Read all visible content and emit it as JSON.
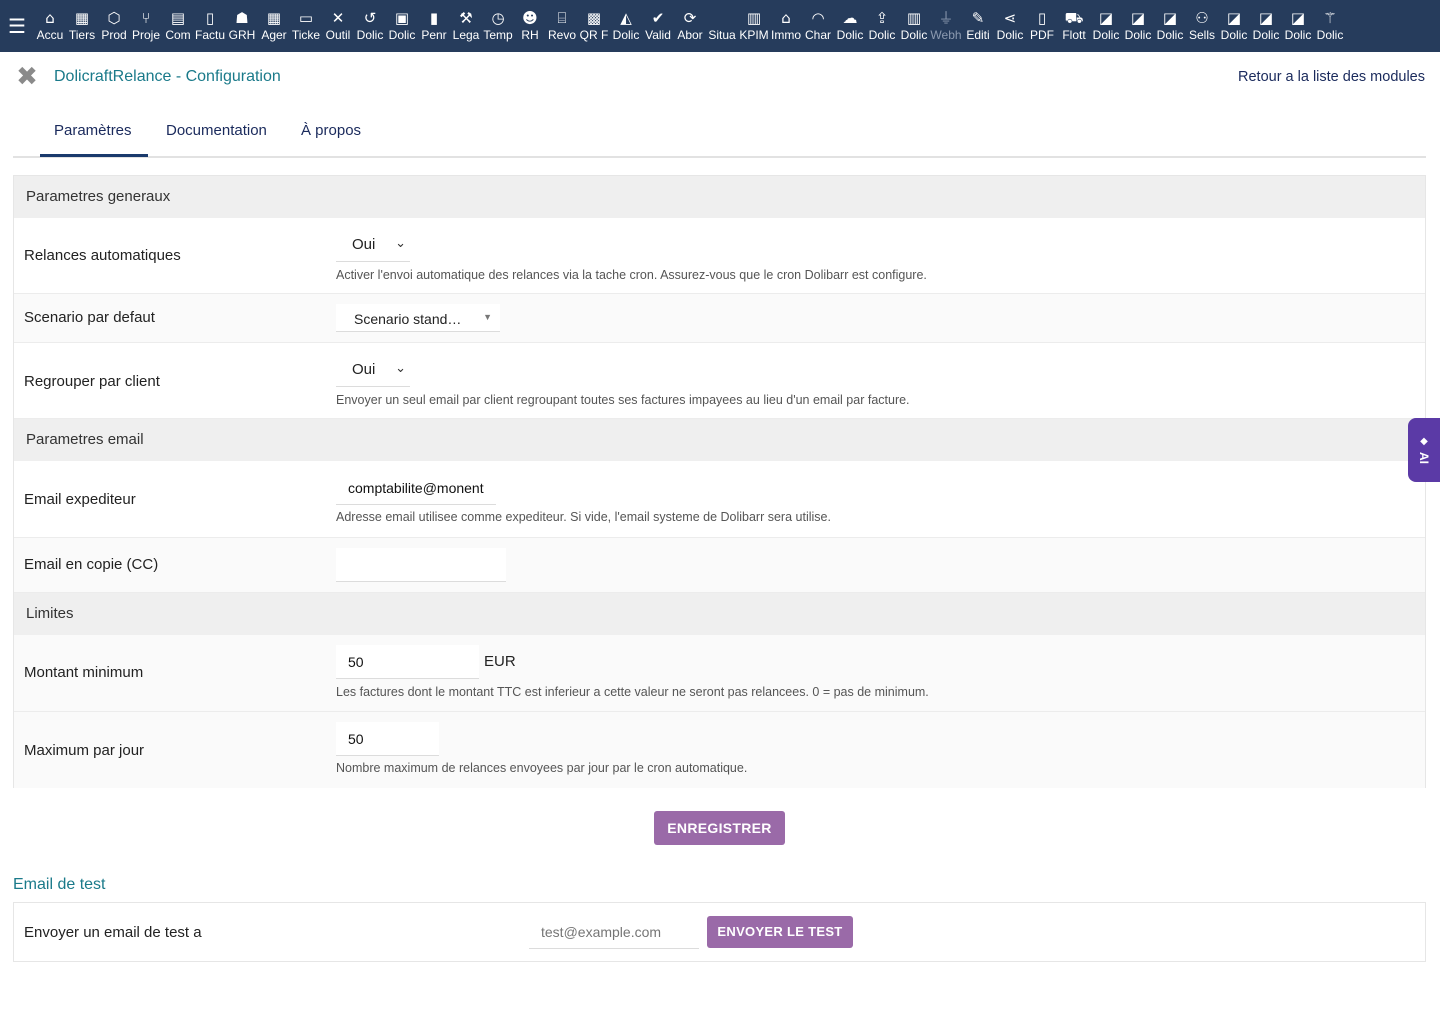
{
  "topbar": {
    "items": [
      {
        "icon": "home-icon",
        "glyph": "⌂",
        "label": "Accu"
      },
      {
        "icon": "building-icon",
        "glyph": "▦",
        "label": "Tiers"
      },
      {
        "icon": "cube-icon",
        "glyph": "⬡",
        "label": "Prod"
      },
      {
        "icon": "project-icon",
        "glyph": "⑂",
        "label": "Proje"
      },
      {
        "icon": "briefcase-icon",
        "glyph": "▤",
        "label": "Com"
      },
      {
        "icon": "invoice-icon",
        "glyph": "▯",
        "label": "Factu"
      },
      {
        "icon": "users-icon",
        "glyph": "☗",
        "label": "GRH"
      },
      {
        "icon": "calendar-icon",
        "glyph": "▦",
        "label": "Ager"
      },
      {
        "icon": "ticket-icon",
        "glyph": "▭",
        "label": "Ticke"
      },
      {
        "icon": "tools-icon",
        "glyph": "✕",
        "label": "Outil"
      },
      {
        "icon": "undo-icon",
        "glyph": "↺",
        "label": "Dolic"
      },
      {
        "icon": "toolbox-icon",
        "glyph": "▣",
        "label": "Dolic"
      },
      {
        "icon": "page-icon",
        "glyph": "▮",
        "label": "Penr"
      },
      {
        "icon": "gavel-icon",
        "glyph": "⚒",
        "label": "Lega"
      },
      {
        "icon": "clock-icon",
        "glyph": "◷",
        "label": "Temp"
      },
      {
        "icon": "team-icon",
        "glyph": "☻",
        "label": "RH"
      },
      {
        "icon": "bank-icon",
        "glyph": "⌸",
        "label": "Revo"
      },
      {
        "icon": "qrcode-icon",
        "glyph": "▩",
        "label": "QR F"
      },
      {
        "icon": "bell-icon",
        "glyph": "◭",
        "label": "Dolic"
      },
      {
        "icon": "check-double-icon",
        "glyph": "✔",
        "label": "Valid"
      },
      {
        "icon": "refresh-icon",
        "glyph": "⟳",
        "label": "Abor"
      },
      {
        "icon": "situation-icon",
        "glyph": " ",
        "label": "Situa"
      },
      {
        "icon": "chart-icon",
        "glyph": "▥",
        "label": "KPIM"
      },
      {
        "icon": "house-icon",
        "glyph": "⌂",
        "label": "Immo"
      },
      {
        "icon": "hard-hat-icon",
        "glyph": "◠",
        "label": "Char"
      },
      {
        "icon": "cloud-icon",
        "glyph": "☁",
        "label": "Dolic"
      },
      {
        "icon": "upload-icon",
        "glyph": "⇪",
        "label": "Dolic"
      },
      {
        "icon": "building2-icon",
        "glyph": "▥",
        "label": "Dolic"
      },
      {
        "icon": "plug-icon",
        "glyph": "⏚",
        "label": "Webh"
      },
      {
        "icon": "edit-icon",
        "glyph": "✎",
        "label": "Editi"
      },
      {
        "icon": "share-icon",
        "glyph": "⋖",
        "label": "Dolic"
      },
      {
        "icon": "pdf-icon",
        "glyph": "▯",
        "label": "PDF"
      },
      {
        "icon": "car-icon",
        "glyph": "⛟",
        "label": "Flott"
      },
      {
        "icon": "note-icon",
        "glyph": "◪",
        "label": "Dolic"
      },
      {
        "icon": "note-icon",
        "glyph": "◪",
        "label": "Dolic"
      },
      {
        "icon": "note-icon",
        "glyph": "◪",
        "label": "Dolic"
      },
      {
        "icon": "handshake-icon",
        "glyph": "⚇",
        "label": "Sells"
      },
      {
        "icon": "note-icon",
        "glyph": "◪",
        "label": "Dolic"
      },
      {
        "icon": "note-icon",
        "glyph": "◪",
        "label": "Dolic"
      },
      {
        "icon": "note-icon",
        "glyph": "◪",
        "label": "Dolic"
      },
      {
        "icon": "magic-wand-icon",
        "glyph": "⚚",
        "label": "Dolic"
      }
    ]
  },
  "header": {
    "title": "DolicraftRelance - Configuration",
    "back_link": "Retour a la liste des modules"
  },
  "tabs": [
    {
      "label": "Paramètres",
      "active": true
    },
    {
      "label": "Documentation",
      "active": false
    },
    {
      "label": "À propos",
      "active": false
    }
  ],
  "sections": {
    "general": {
      "title": "Parametres generaux",
      "relances_auto": {
        "label": "Relances automatiques",
        "value": "Oui",
        "help": "Activer l'envoi automatique des relances via la tache cron. Assurez-vous que le cron Dolibarr est configure."
      },
      "scenario": {
        "label": "Scenario par defaut",
        "value": "Scenario stand…"
      },
      "regrouper": {
        "label": "Regrouper par client",
        "value": "Oui",
        "help": "Envoyer un seul email par client regroupant toutes ses factures impayees au lieu d'un email par facture."
      }
    },
    "email": {
      "title": "Parametres email",
      "sender": {
        "label": "Email expediteur",
        "value": "comptabilite@monentre",
        "help": "Adresse email utilisee comme expediteur. Si vide, l'email systeme de Dolibarr sera utilise."
      },
      "cc": {
        "label": "Email en copie (CC)",
        "value": ""
      }
    },
    "limits": {
      "title": "Limites",
      "min_amount": {
        "label": "Montant minimum",
        "value": "50",
        "unit": "EUR",
        "help": "Les factures dont le montant TTC est inferieur a cette valeur ne seront pas relancees. 0 = pas de minimum."
      },
      "max_per_day": {
        "label": "Maximum par jour",
        "value": "50",
        "help": "Nombre maximum de relances envoyees par jour par le cron automatique."
      }
    }
  },
  "save_button": "ENREGISTRER",
  "test": {
    "title": "Email de test",
    "label": "Envoyer un email de test a",
    "placeholder": "test@example.com",
    "button": "ENVOYER LE TEST"
  },
  "ai_tab": {
    "label": "AI"
  },
  "colors": {
    "topbar": "#263c5c",
    "accent_title": "#1a7a8a",
    "button": "#9a6aa8",
    "ai_tab": "#5b3aa6"
  }
}
